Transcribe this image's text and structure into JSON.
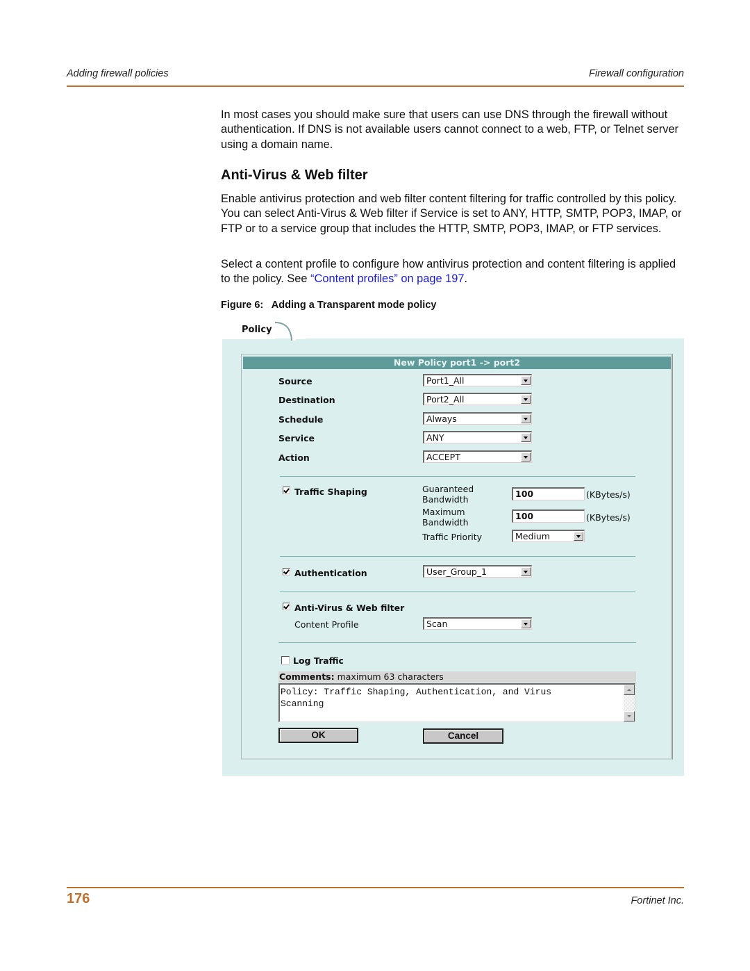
{
  "header": {
    "left": "Adding firewall policies",
    "right": "Firewall configuration"
  },
  "intro_paragraph": "In most cases you should make sure that users can use DNS through the firewall without authentication. If DNS is not available users cannot connect to a web, FTP, or Telnet server using a domain name.",
  "section": {
    "title": "Anti-Virus & Web filter",
    "paragraph1": "Enable antivirus protection and web filter content filtering for traffic controlled by this policy. You can select Anti-Virus & Web filter if Service is set to ANY, HTTP, SMTP, POP3, IMAP, or FTP or to a service group that includes the HTTP, SMTP, POP3, IMAP, or FTP services.",
    "paragraph2_prefix": "Select a content profile to configure how antivirus protection and content filtering is applied to the policy. See ",
    "paragraph2_link": "“Content profiles” on page 197",
    "paragraph2_suffix": "."
  },
  "figure": {
    "caption": "Figure 6:   Adding a Transparent mode policy"
  },
  "policy_ui": {
    "tab_label": "Policy",
    "title": "New Policy port1 -> port2",
    "fields": [
      {
        "label": "Source",
        "value": "Port1_All"
      },
      {
        "label": "Destination",
        "value": "Port2_All"
      },
      {
        "label": "Schedule",
        "value": "Always"
      },
      {
        "label": "Service",
        "value": "ANY"
      },
      {
        "label": "Action",
        "value": "ACCEPT"
      }
    ],
    "traffic_shaping": {
      "label": "Traffic Shaping",
      "checked": true,
      "guaranteed_label_1": "Guaranteed",
      "guaranteed_label_2": "Bandwidth",
      "guaranteed_value": "100",
      "maximum_label_1": "Maximum",
      "maximum_label_2": "Bandwidth",
      "maximum_value": "100",
      "unit": "(KBytes/s)",
      "priority_label": "Traffic Priority",
      "priority_value": "Medium"
    },
    "authentication": {
      "label": "Authentication",
      "checked": true,
      "value": "User_Group_1"
    },
    "antivirus": {
      "label": "Anti-Virus & Web filter",
      "checked": true,
      "profile_label": "Content Profile",
      "profile_value": "Scan"
    },
    "log_traffic": {
      "label": "Log Traffic",
      "checked": false
    },
    "comments": {
      "label_bold": "Comments:",
      "label_rest": " maximum 63 characters",
      "value": "Policy: Traffic Shaping, Authentication, and Virus\nScanning"
    },
    "buttons": {
      "ok": "OK",
      "cancel": "Cancel"
    }
  },
  "footer": {
    "page_number": "176",
    "company": "Fortinet Inc."
  },
  "colors": {
    "accent_rule": "#c0702a",
    "link": "#1a1adb",
    "panel_bg": "#dcefef",
    "title_bar": "#5f9b9a"
  }
}
